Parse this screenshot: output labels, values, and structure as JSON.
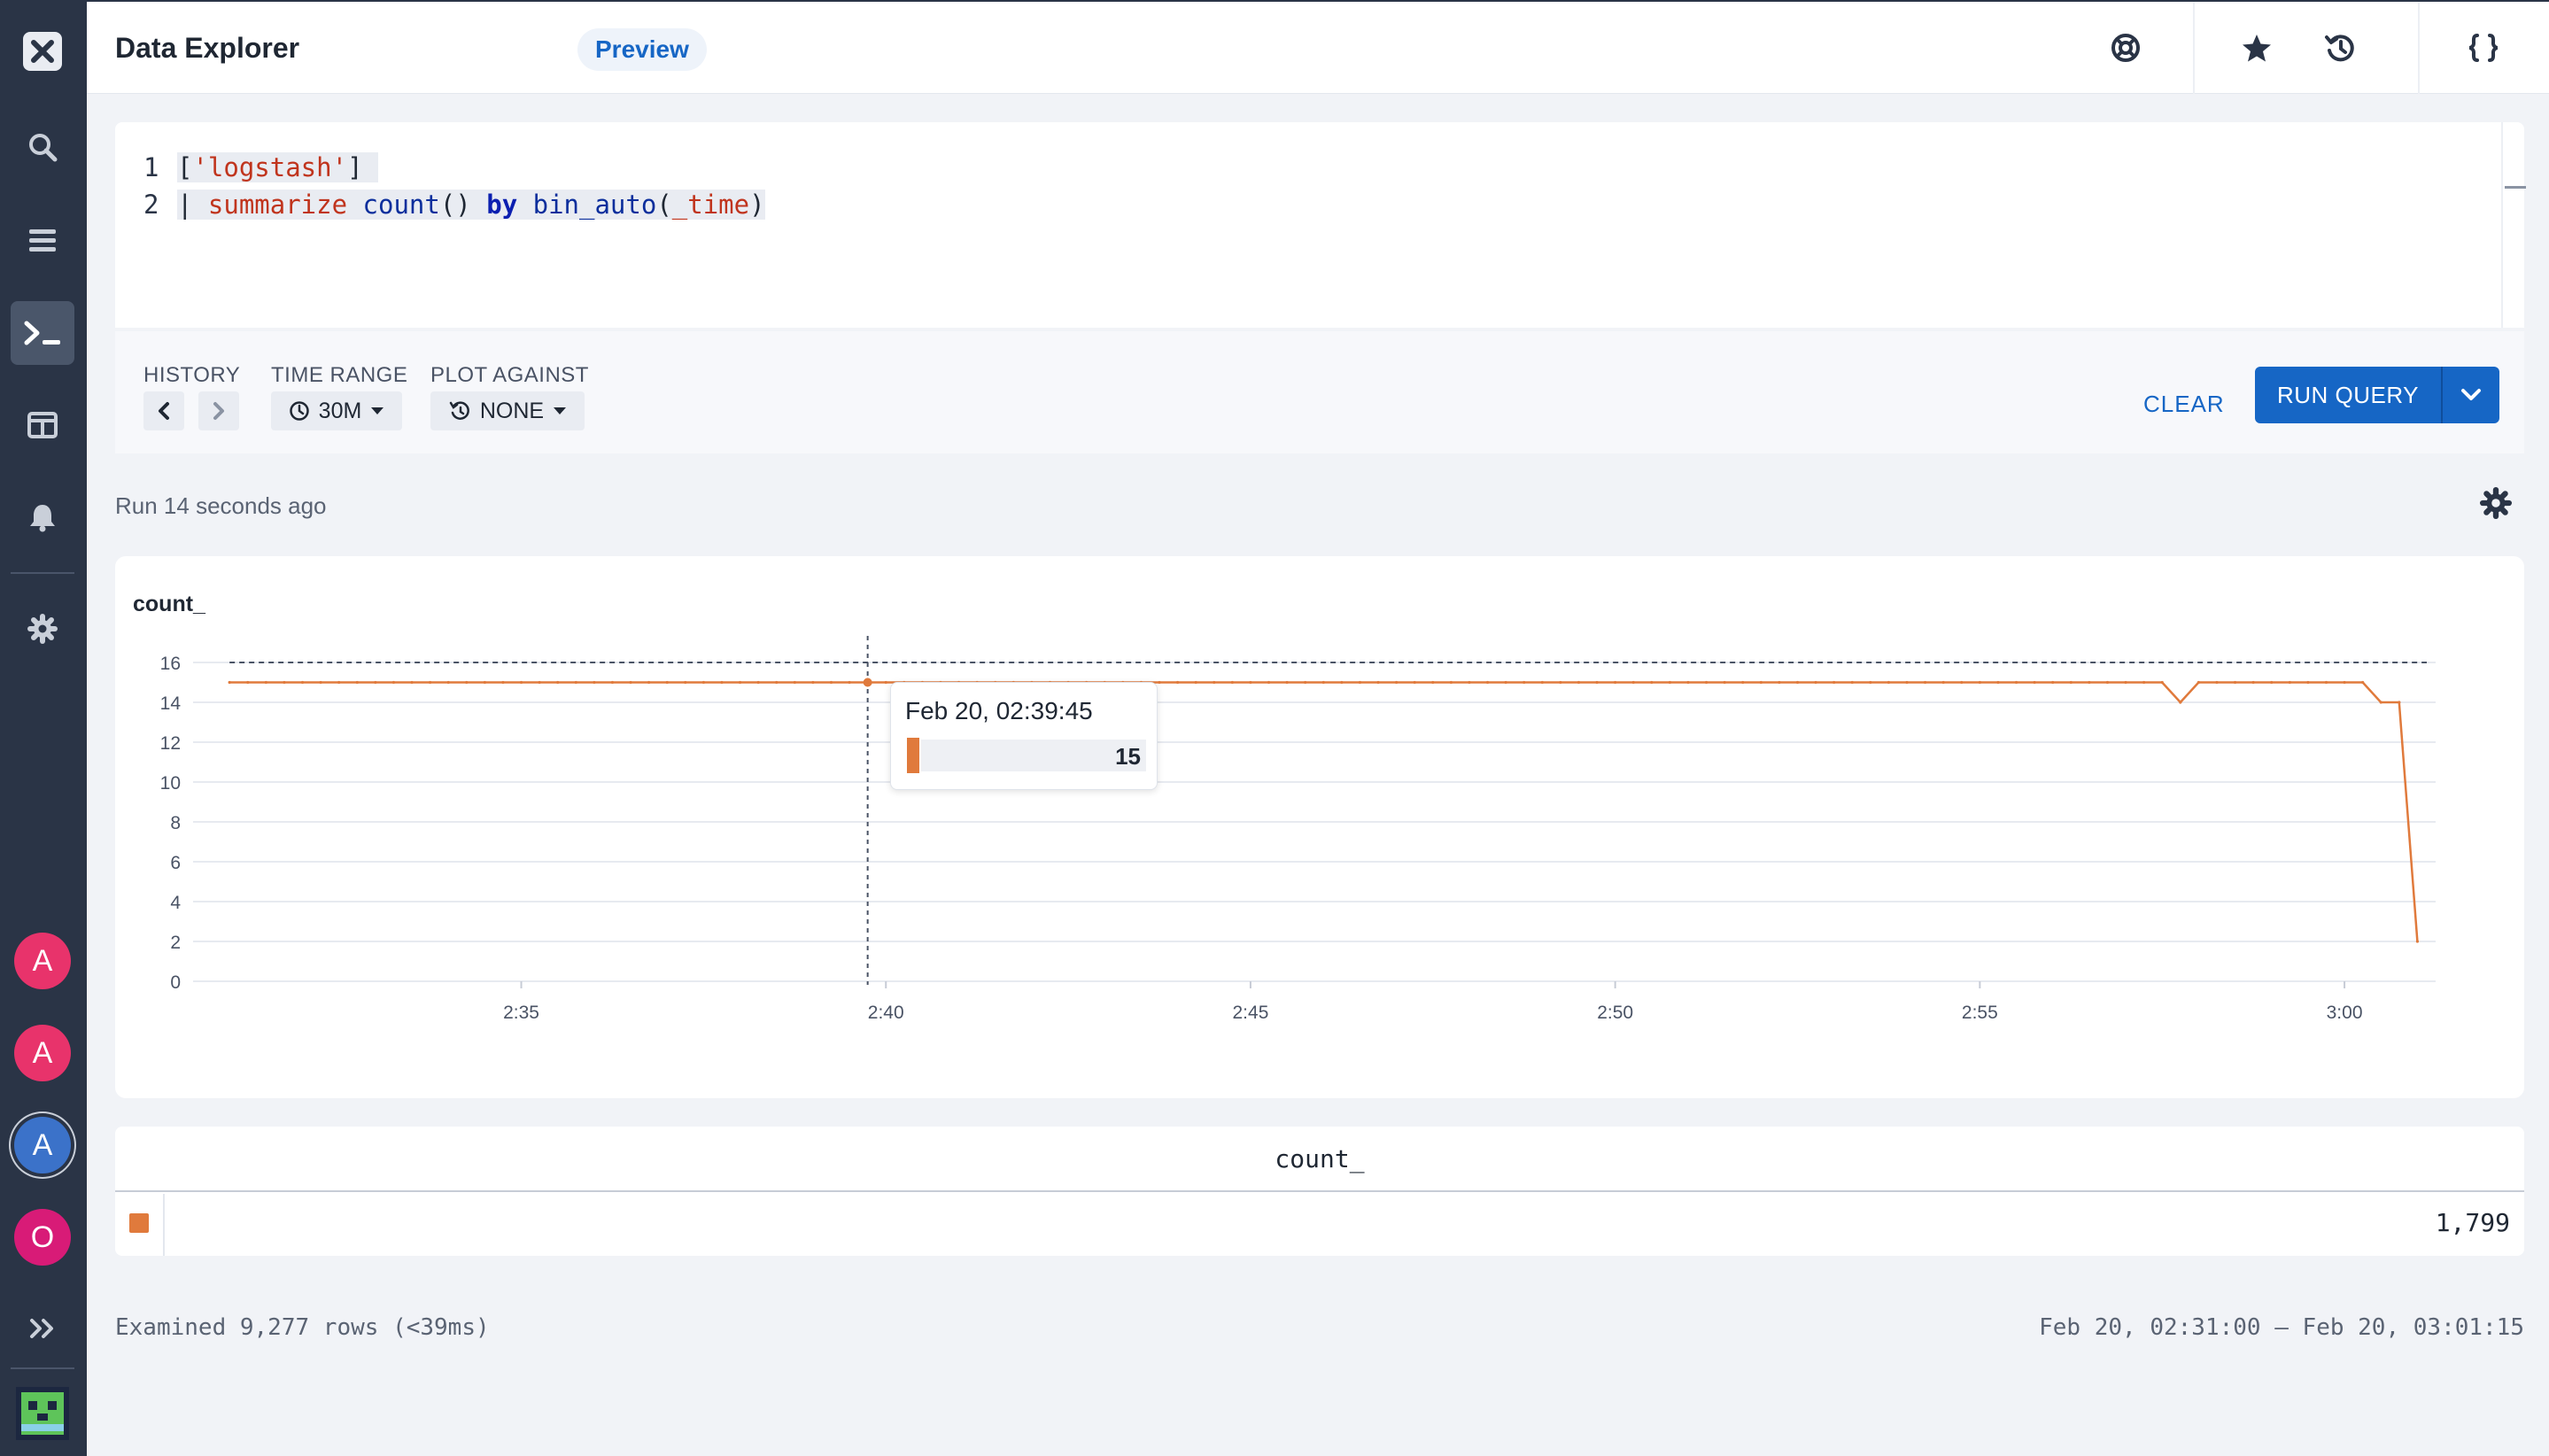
{
  "header": {
    "title": "Data Explorer",
    "badge": "Preview",
    "icons": [
      "help-icon",
      "star-icon",
      "history-icon",
      "braces-icon"
    ]
  },
  "sidebar": {
    "icons": [
      "axiom-logo-icon",
      "search-icon",
      "stream-icon",
      "terminal-icon",
      "dashboard-icon",
      "bell-icon",
      "gear-icon"
    ],
    "avatars": [
      {
        "letter": "A",
        "color": "#e8336b"
      },
      {
        "letter": "A",
        "color": "#e8336b"
      },
      {
        "letter": "A",
        "color": "#3b72c9"
      },
      {
        "letter": "O",
        "color": "#d81b77"
      }
    ],
    "expand_icon": "chevrons-right-icon"
  },
  "editor": {
    "line1_num": "1",
    "line2_num": "2",
    "line1": {
      "open": "[",
      "dataset": "'logstash'",
      "close": "]"
    },
    "line2": {
      "pipe": "| ",
      "kw": "summarize",
      "fn": "count",
      "parens": "()",
      "by": "by",
      "fn2": "bin_auto",
      "arg": "_time",
      "open": "(",
      "close": ")"
    }
  },
  "toolbar": {
    "history_label": "HISTORY",
    "time_range_label": "TIME RANGE",
    "time_range_value": "30M",
    "plot_against_label": "PLOT AGAINST",
    "plot_against_value": "NONE",
    "clear_label": "CLEAR",
    "run_query_label": "RUN QUERY"
  },
  "status": {
    "run_text": "Run 14 seconds ago"
  },
  "chart_data": {
    "type": "line",
    "title": "",
    "ylabel": "count_",
    "xlabel": "",
    "ylim": [
      0,
      16
    ],
    "y_ticks": [
      0,
      2,
      4,
      6,
      8,
      10,
      12,
      14,
      16
    ],
    "x_ticks": [
      "2:35",
      "2:40",
      "2:45",
      "2:50",
      "2:55",
      "3:00"
    ],
    "x_tick_minutes": [
      35,
      40,
      45,
      50,
      55,
      60
    ],
    "x_range_minutes": [
      30.5,
      61.25
    ],
    "series_color": "#e07a3c",
    "series": [
      {
        "name": "count_",
        "points": [
          [
            31.0,
            15
          ],
          [
            39.75,
            15
          ],
          [
            57.5,
            15
          ],
          [
            57.75,
            14
          ],
          [
            58.0,
            15
          ],
          [
            60.25,
            15
          ],
          [
            60.5,
            14
          ],
          [
            60.75,
            14
          ],
          [
            61.0,
            2
          ]
        ]
      }
    ],
    "reference_line": 16,
    "hover": {
      "minute": 39.75,
      "label": "Feb 20, 02:39:45",
      "value": "15"
    }
  },
  "table": {
    "column": "count_",
    "value": "1,799",
    "swatch_color": "#e07a3c"
  },
  "footer": {
    "examined": "Examined 9,277 rows (<39ms)",
    "range": "Feb 20, 02:31:00 — Feb 20, 03:01:15"
  }
}
